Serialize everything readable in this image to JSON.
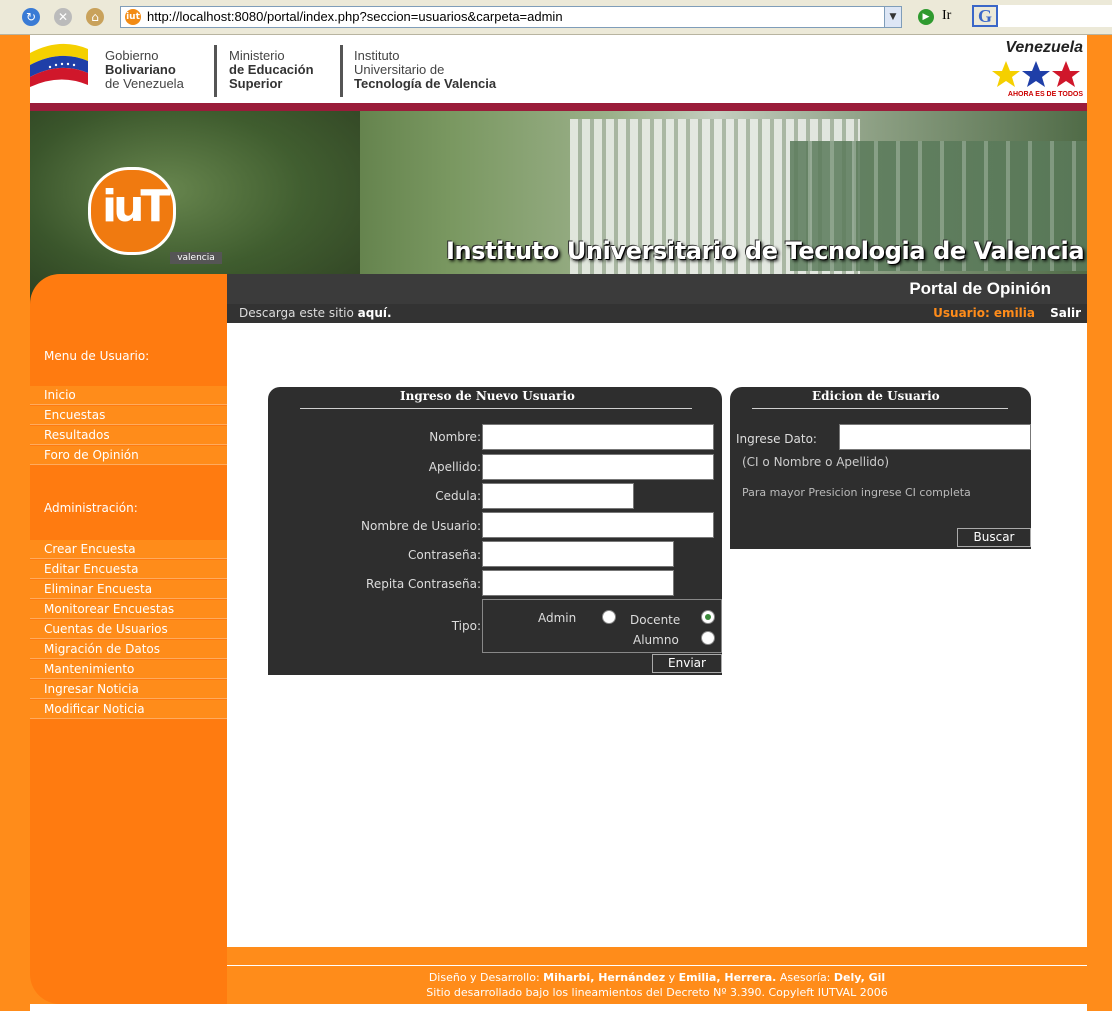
{
  "browser": {
    "url": "http://localhost:8080/portal/index.php?seccion=usuarios&carpeta=admin",
    "go_label": "Ir",
    "g_label": "G"
  },
  "gov": {
    "col1": [
      "Gobierno",
      "Bolivariano",
      "de Venezuela"
    ],
    "col2": [
      "Ministerio",
      "de Educación",
      "Superior"
    ],
    "col3": [
      "Instituto",
      "Universitario de",
      "Tecnología de Valencia"
    ],
    "venezuela": "Venezuela",
    "venezuela_sub": "AHORA ES DE TODOS"
  },
  "banner": {
    "logo_text": "iuT",
    "logo_sub": "valencia",
    "title": "Instituto Universitario de Tecnologia de Valencia"
  },
  "portal": {
    "title": "Portal de Opinión",
    "download_text": "Descarga este sitio",
    "download_link": "aquí.",
    "user_label": "Usuario: emilia",
    "logout": "Salir"
  },
  "sidebar": {
    "menu_title": "Menu de Usuario:",
    "menu_items": [
      "Inicio",
      "Encuestas",
      "Resultados",
      "Foro de Opinión"
    ],
    "admin_title": "Administración:",
    "admin_items": [
      "Crear Encuesta",
      "Editar Encuesta",
      "Eliminar Encuesta",
      "Monitorear Encuestas",
      "Cuentas de Usuarios",
      "Migración de Datos",
      "Mantenimiento",
      "Ingresar Noticia",
      "Modificar Noticia"
    ]
  },
  "new_user": {
    "title": "Ingreso de Nuevo Usuario",
    "fields": [
      "Nombre:",
      "Apellido:",
      "Cedula:",
      "Nombre de Usuario:",
      "Contraseña:",
      "Repita Contraseña:"
    ],
    "tipo_label": "Tipo:",
    "options": [
      "Admin",
      "Docente",
      "Alumno"
    ],
    "selected": "Docente",
    "submit": "Enviar"
  },
  "edit_user": {
    "title": "Edicion de Usuario",
    "label": "Ingrese Dato:",
    "hint": "(CI o Nombre o Apellido)",
    "note": "Para mayor Presicion ingrese CI completa",
    "button": "Buscar"
  },
  "footer": {
    "line1_a": "Diseño y Desarrollo:",
    "line1_b": "Miharbi, Hernández",
    "line1_c": "y",
    "line1_d": "Emilia, Herrera.",
    "line1_e": "Asesoría:",
    "line1_f": "Dely, Gil",
    "line2": "Sitio desarrollado bajo los lineamientos del Decreto Nº 3.390. Copyleft IUTVAL 2006"
  }
}
